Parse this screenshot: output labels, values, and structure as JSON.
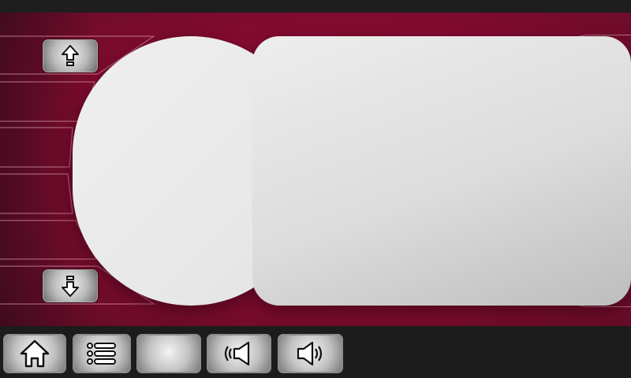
{
  "colors": {
    "background_red": "#8a0b32",
    "panel_gray": "#e6e6e6",
    "bar_dark": "#1c1c1c"
  },
  "side_nav": {
    "up_icon": "arrow-up-icon",
    "down_icon": "arrow-down-icon"
  },
  "toolbar": {
    "buttons": [
      {
        "icon": "home-icon"
      },
      {
        "icon": "list-menu-icon"
      },
      {
        "icon": "blank"
      },
      {
        "icon": "volume-down-icon"
      },
      {
        "icon": "volume-up-icon"
      }
    ]
  }
}
